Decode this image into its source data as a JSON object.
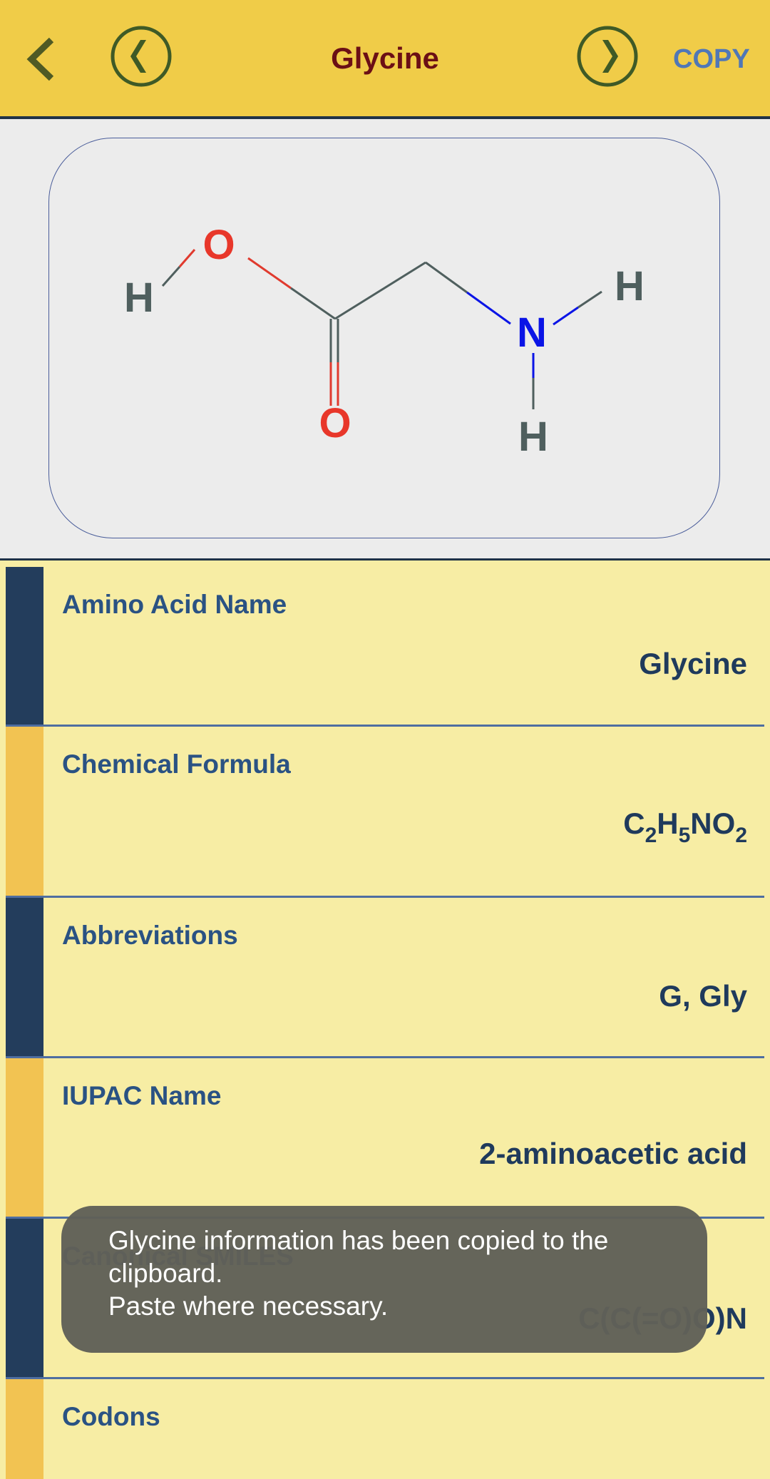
{
  "header": {
    "title": "Glycine",
    "copy_label": "COPY",
    "back_icon": "chevron-left-icon",
    "prev_icon": "circle-chevron-left-icon",
    "next_icon": "circle-chevron-right-icon"
  },
  "structure": {
    "atoms": [
      {
        "symbol": "H",
        "color": "#4f5f5e"
      },
      {
        "symbol": "O",
        "color": "#e8372a"
      },
      {
        "symbol": "O",
        "color": "#e8372a"
      },
      {
        "symbol": "N",
        "color": "#0a14e6"
      },
      {
        "symbol": "H",
        "color": "#4f5f5e"
      },
      {
        "symbol": "H",
        "color": "#4f5f5e"
      }
    ]
  },
  "rows": [
    {
      "label": "Amino Acid Name",
      "value": "Glycine",
      "accent": "#233d5c"
    },
    {
      "label": "Chemical Formula",
      "value_parts": [
        [
          "C",
          "2"
        ],
        [
          "H",
          "5"
        ],
        [
          "N",
          ""
        ],
        [
          "O",
          "2"
        ]
      ],
      "accent": "#f2c352"
    },
    {
      "label": "Abbreviations",
      "value": "G, Gly",
      "accent": "#233d5c"
    },
    {
      "label": "IUPAC Name",
      "value": "2-aminoacetic acid",
      "accent": "#f2c352"
    },
    {
      "label": "Canonical SMILES",
      "value": "C(C(=O)O)N",
      "accent": "#233d5c"
    },
    {
      "label": "Codons",
      "value": "",
      "accent": "#f2c352"
    }
  ],
  "toast": {
    "line1": "Glycine information has been copied to the clipboard.",
    "line2": "Paste where necessary."
  }
}
